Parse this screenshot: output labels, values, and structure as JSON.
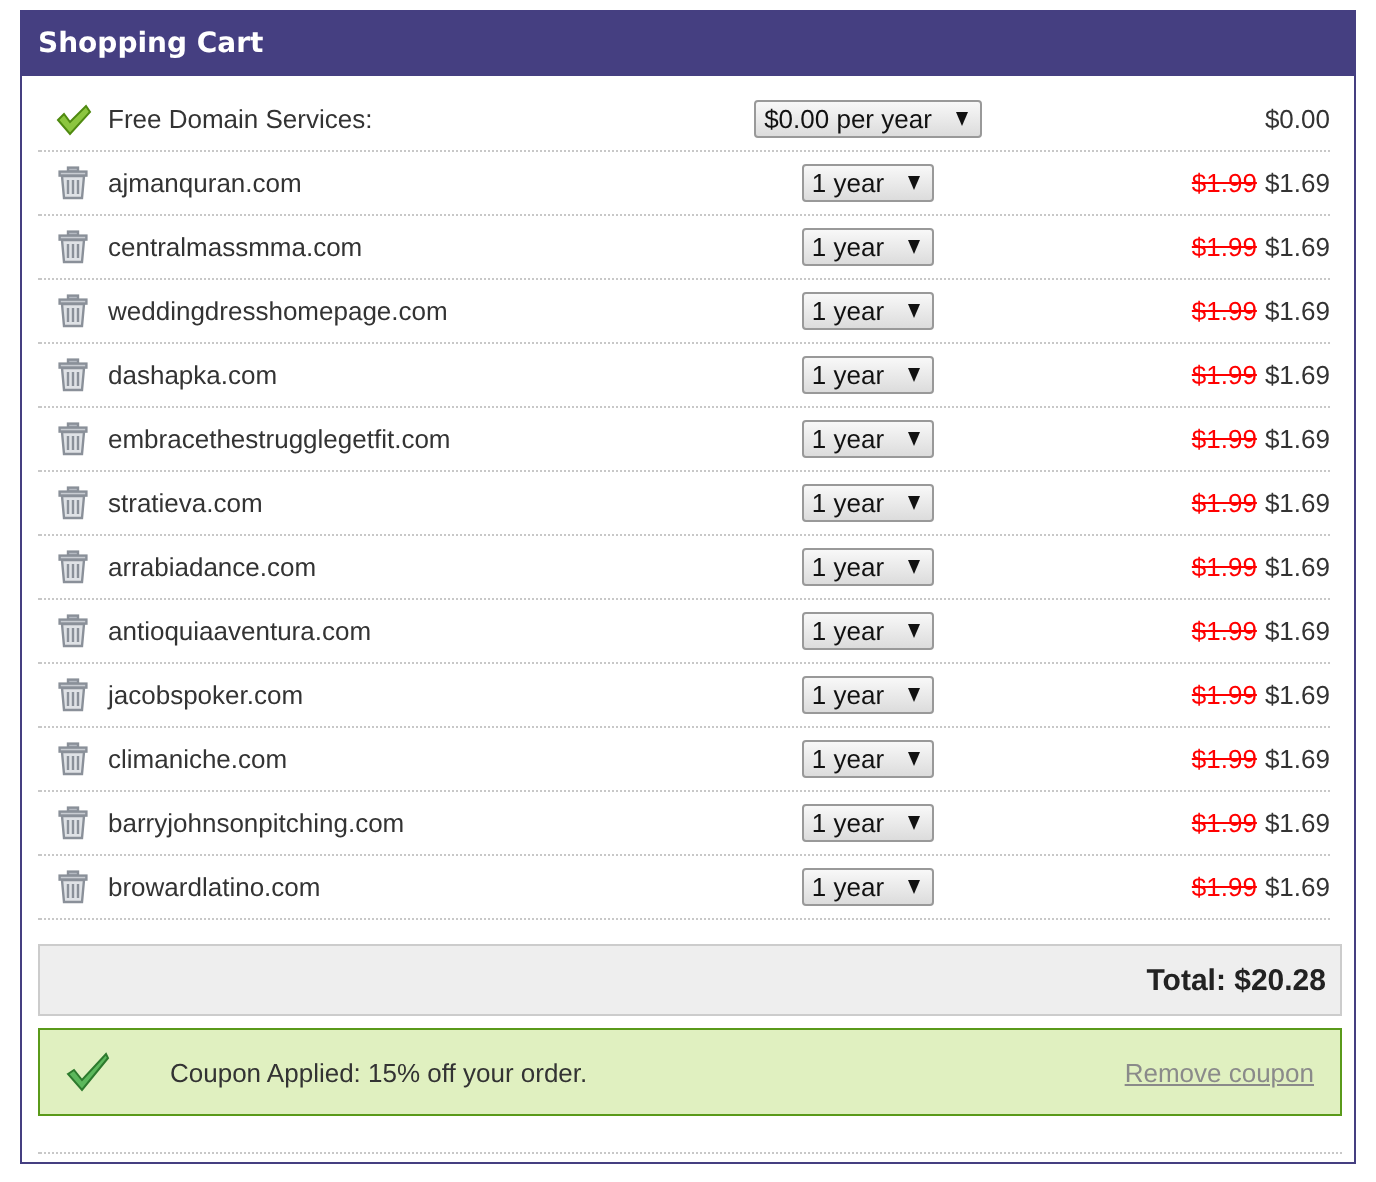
{
  "panel": {
    "title": "Shopping Cart"
  },
  "items": [
    {
      "kind": "free",
      "name": "Free Domain Services:",
      "term": "$0.00 per year",
      "price": "$0.00"
    },
    {
      "kind": "domain",
      "name": "ajmanquran.com",
      "term": "1 year",
      "old_price": "$1.99",
      "price": "$1.69"
    },
    {
      "kind": "domain",
      "name": "centralmassmma.com",
      "term": "1 year",
      "old_price": "$1.99",
      "price": "$1.69"
    },
    {
      "kind": "domain",
      "name": "weddingdresshomepage.com",
      "term": "1 year",
      "old_price": "$1.99",
      "price": "$1.69"
    },
    {
      "kind": "domain",
      "name": "dashapka.com",
      "term": "1 year",
      "old_price": "$1.99",
      "price": "$1.69"
    },
    {
      "kind": "domain",
      "name": "embracethestrugglegetfit.com",
      "term": "1 year",
      "old_price": "$1.99",
      "price": "$1.69"
    },
    {
      "kind": "domain",
      "name": "stratieva.com",
      "term": "1 year",
      "old_price": "$1.99",
      "price": "$1.69"
    },
    {
      "kind": "domain",
      "name": "arrabiadance.com",
      "term": "1 year",
      "old_price": "$1.99",
      "price": "$1.69"
    },
    {
      "kind": "domain",
      "name": "antioquiaaventura.com",
      "term": "1 year",
      "old_price": "$1.99",
      "price": "$1.69"
    },
    {
      "kind": "domain",
      "name": "jacobspoker.com",
      "term": "1 year",
      "old_price": "$1.99",
      "price": "$1.69"
    },
    {
      "kind": "domain",
      "name": "climaniche.com",
      "term": "1 year",
      "old_price": "$1.99",
      "price": "$1.69"
    },
    {
      "kind": "domain",
      "name": "barryjohnsonpitching.com",
      "term": "1 year",
      "old_price": "$1.99",
      "price": "$1.69"
    },
    {
      "kind": "domain",
      "name": "browardlatino.com",
      "term": "1 year",
      "old_price": "$1.99",
      "price": "$1.69"
    }
  ],
  "total": "Total: $20.28",
  "coupon": {
    "message": "Coupon Applied: 15% off your order.",
    "link": "Remove coupon"
  }
}
